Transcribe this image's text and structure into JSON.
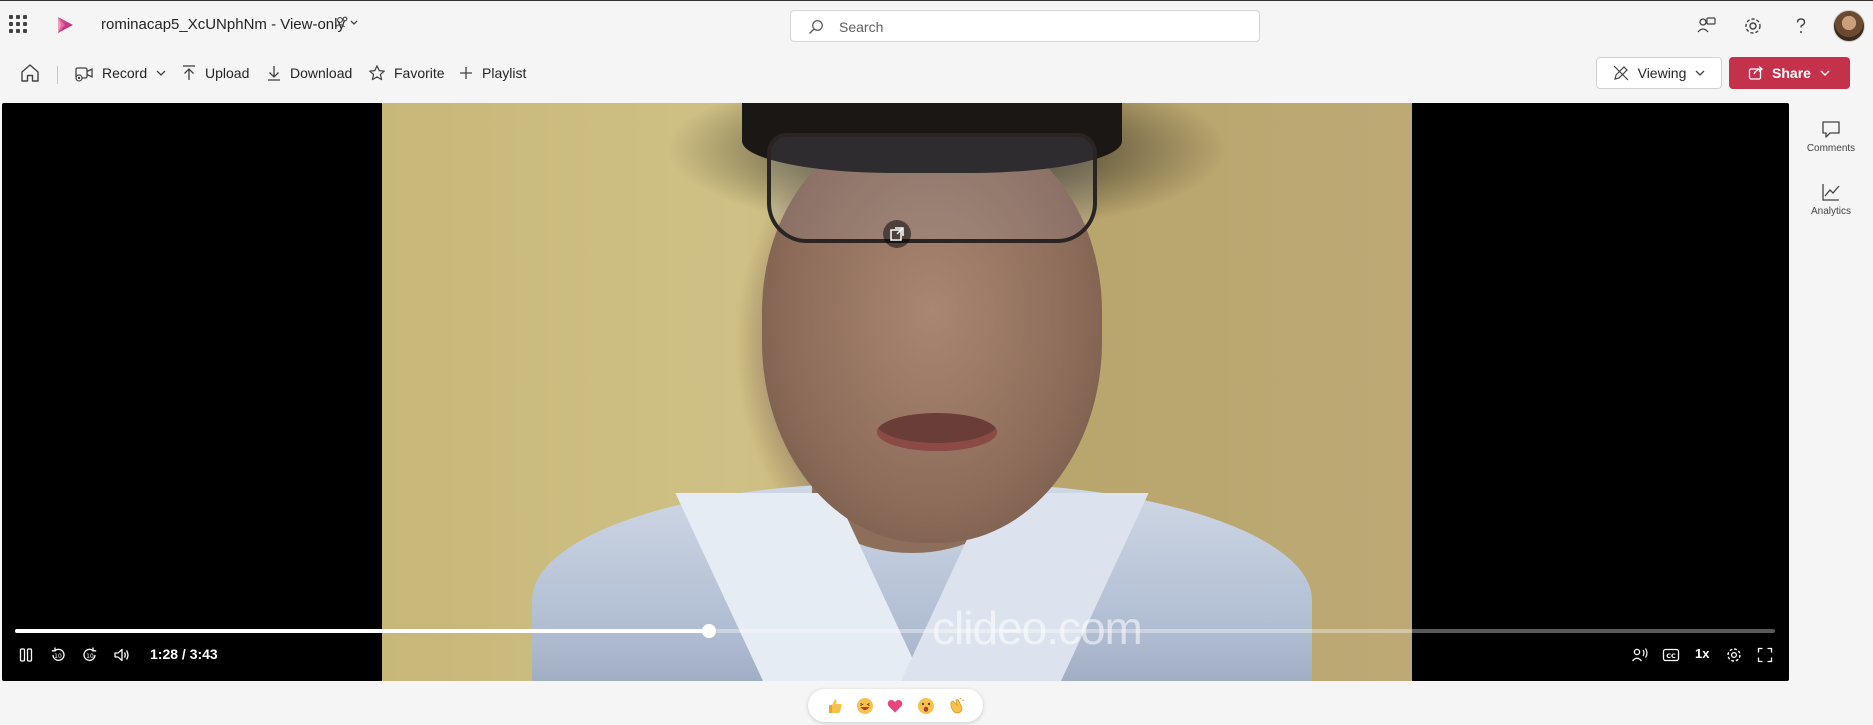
{
  "header": {
    "title": "rominacap5_XcUNphNm - View-only",
    "search_placeholder": "Search",
    "brand_color": "#c4314b"
  },
  "toolbar": {
    "record_label": "Record",
    "upload_label": "Upload",
    "download_label": "Download",
    "favorite_label": "Favorite",
    "playlist_label": "Playlist",
    "viewing_label": "Viewing",
    "share_label": "Share"
  },
  "player": {
    "time_display": "1:28 / 3:43",
    "progress_fraction": 0.3946,
    "playback_rate": "1x",
    "watermark": "clideo.com"
  },
  "side_panel": {
    "comments_label": "Comments",
    "analytics_label": "Analytics"
  },
  "reactions": [
    {
      "name": "like-reaction",
      "icon": "thumbs-up-icon"
    },
    {
      "name": "laugh-reaction",
      "icon": "laugh-icon"
    },
    {
      "name": "heart-reaction",
      "icon": "heart-icon"
    },
    {
      "name": "surprised-reaction",
      "icon": "surprised-icon"
    },
    {
      "name": "applause-reaction",
      "icon": "clap-icon"
    }
  ]
}
